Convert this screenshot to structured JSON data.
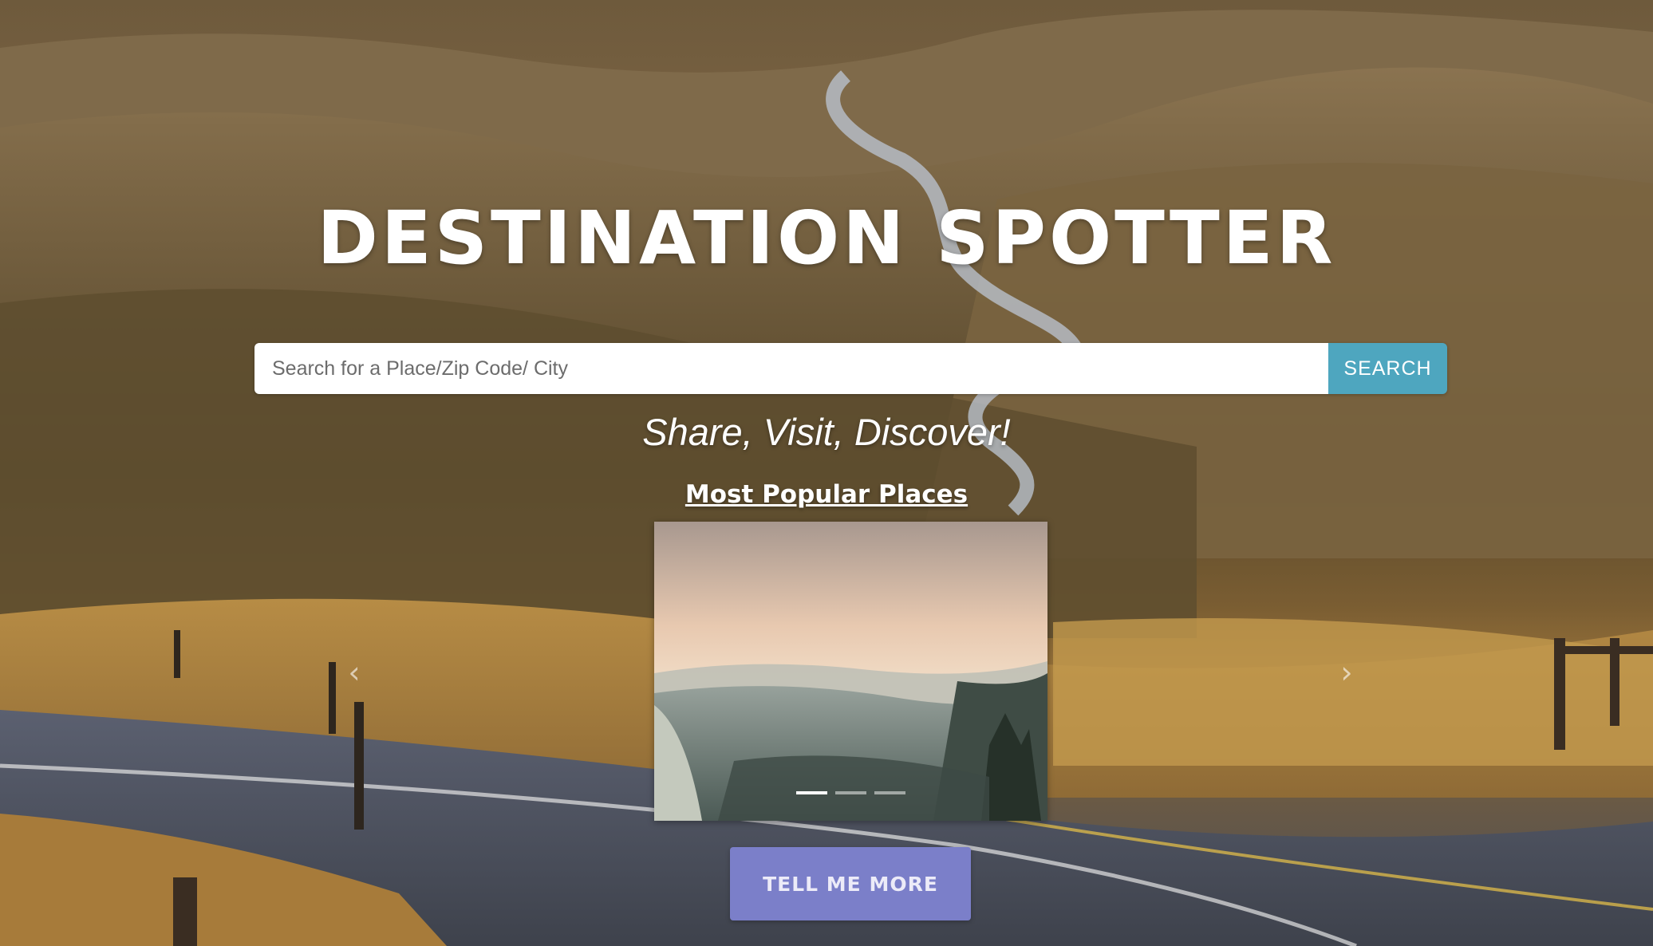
{
  "hero": {
    "title": "DESTINATION SPOTTER",
    "tagline": "Share, Visit, Discover!"
  },
  "search": {
    "placeholder": "Search for a Place/Zip Code/ City",
    "value": "",
    "button_label": "SEARCH"
  },
  "popular": {
    "heading": "Most Popular Places",
    "carousel": {
      "slide_count": 3,
      "active_index": 0,
      "prev_icon": "chevron-left-icon",
      "next_icon": "chevron-right-icon"
    }
  },
  "cta": {
    "label": "TELL ME MORE"
  },
  "colors": {
    "search_button": "#4ea6bf",
    "cta_button": "#7b7fc9",
    "title_text": "#ffffff"
  }
}
